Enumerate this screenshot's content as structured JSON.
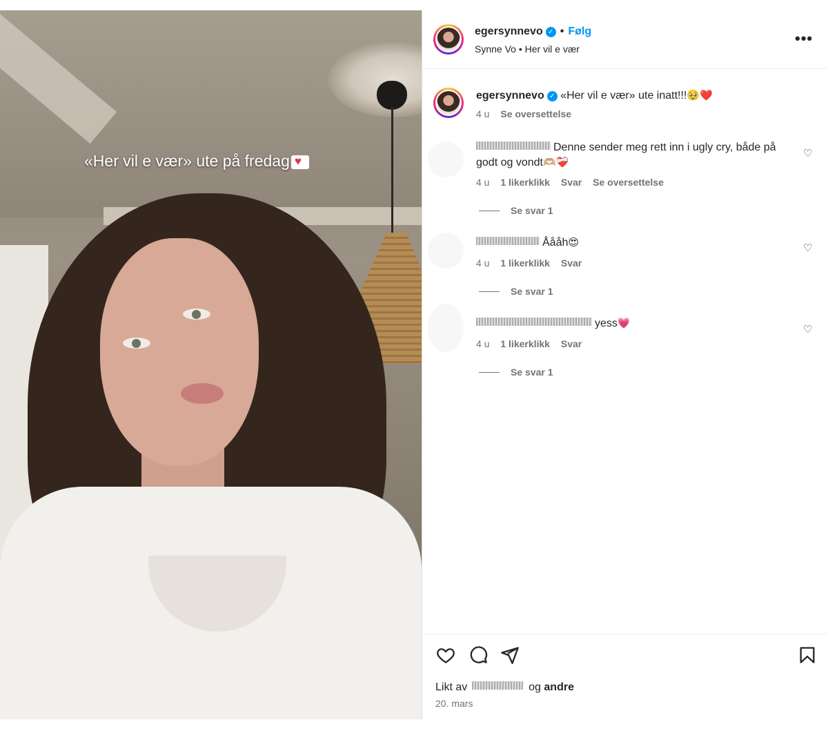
{
  "media": {
    "overlay_text": "«Her vil e vær» ute på fredag"
  },
  "header": {
    "username": "egersynnevo",
    "follow_label": "Følg",
    "subtitle": "Synne Vo • Her vil e vær",
    "more_label": "•••"
  },
  "caption": {
    "username": "egersynnevo",
    "text": "«Her vil e vær» ute inatt!!!",
    "emoji": "🥹❤️",
    "time": "4 u",
    "translate": "Se oversettelse"
  },
  "comments": [
    {
      "text": "Denne sender meg rett inn i ugly cry, både på godt og vondt",
      "emoji": "🫶🏼❤️‍🩹",
      "time": "4 u",
      "likes": "1 likerklikk",
      "reply": "Svar",
      "translate": "Se oversettelse",
      "view_replies": "Se svar 1"
    },
    {
      "text": "Åååh",
      "emoji": "😍",
      "time": "4 u",
      "likes": "1 likerklikk",
      "reply": "Svar",
      "view_replies": "Se svar 1"
    },
    {
      "text": "yess",
      "emoji": "💗",
      "time": "4 u",
      "likes": "1 likerklikk",
      "reply": "Svar",
      "view_replies": "Se svar 1"
    }
  ],
  "footer": {
    "liked_prefix": "Likt av",
    "liked_suffix": "og",
    "liked_others": "andre",
    "date": "20. mars"
  },
  "colors": {
    "accent": "#0095f6",
    "text": "#262626",
    "muted": "#737373"
  }
}
